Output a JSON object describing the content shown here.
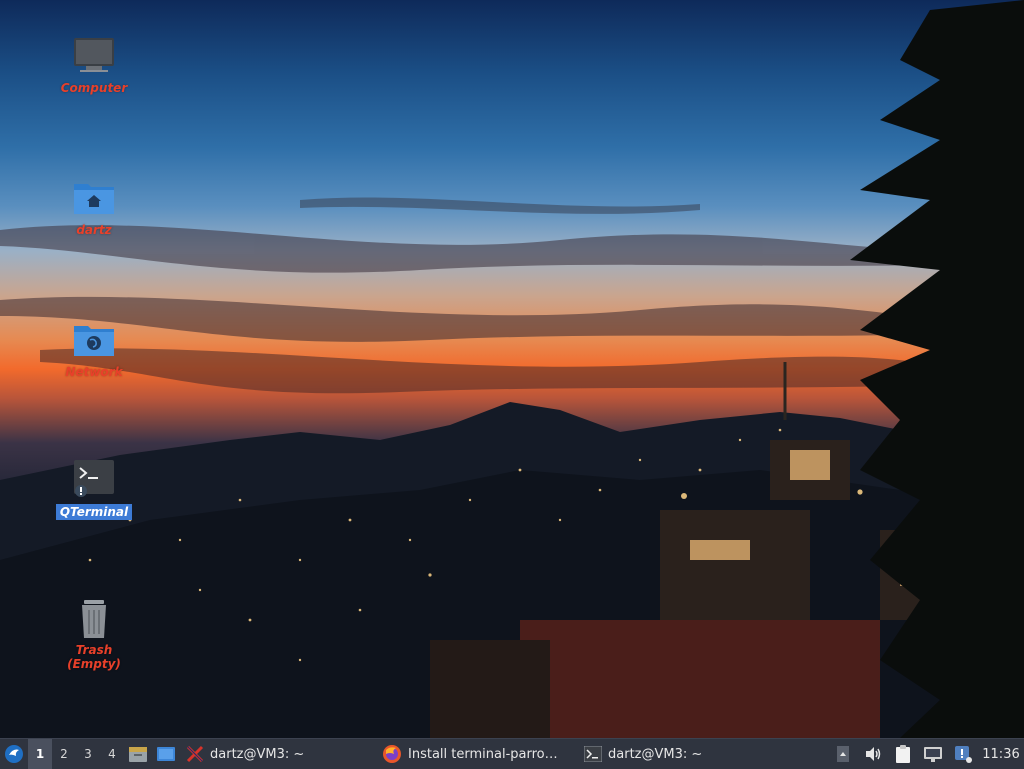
{
  "desktop": {
    "icons": [
      {
        "label": "Computer",
        "icon": "computer-icon"
      },
      {
        "label": "dartz",
        "icon": "home-folder-icon"
      },
      {
        "label": "Network",
        "icon": "network-folder-icon"
      },
      {
        "label": "QTerminal",
        "icon": "terminal-icon"
      },
      {
        "label": "Trash (Empty)",
        "icon": "trash-icon"
      }
    ]
  },
  "taskbar": {
    "workspaces": [
      "1",
      "2",
      "3",
      "4"
    ],
    "active_workspace": "1",
    "tasks": [
      {
        "label": "dartz@VM3: ~",
        "icon": "x-terminal-icon"
      },
      {
        "label": "Install terminal-parro…",
        "icon": "firefox-icon"
      },
      {
        "label": "dartz@VM3: ~",
        "icon": "terminal-icon"
      }
    ],
    "clock": "11:36"
  },
  "colors": {
    "icon_label": "#e8402a",
    "selection": "#3d7bd6",
    "panel": "#2f343f"
  }
}
